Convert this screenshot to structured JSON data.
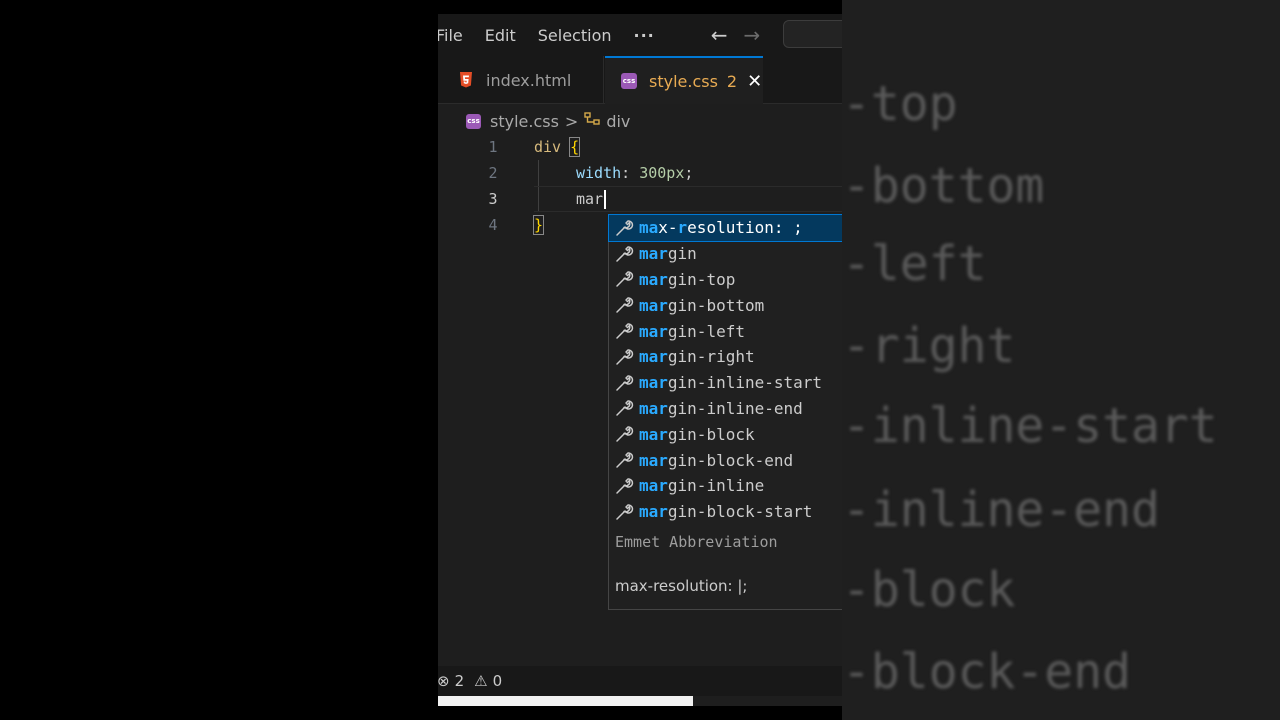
{
  "menubar": {
    "items": [
      "File",
      "Edit",
      "Selection",
      "···"
    ],
    "back_arrow": "←",
    "forward_arrow": "→"
  },
  "tabs": [
    {
      "label": "index.html",
      "icon": "html5-icon"
    },
    {
      "label": "style.css",
      "icon": "css-file-icon",
      "badge": "2",
      "close": "✕"
    }
  ],
  "breadcrumb": {
    "file": "style.css",
    "separator": ">",
    "symbol": "div"
  },
  "editor": {
    "line_numbers": [
      "1",
      "2",
      "3",
      "4"
    ],
    "line1": {
      "selector": "div",
      "brace": "{"
    },
    "line2": {
      "property": "width",
      "colon": ":",
      "value": "300px",
      "semi": ";"
    },
    "line3": {
      "typed": "mar"
    },
    "line4": {
      "brace": "}"
    }
  },
  "suggestions": {
    "query": "mar",
    "items": [
      {
        "prefix": "ma",
        "mid": "x-",
        "hl2": "r",
        "rest": "esolution: ;"
      },
      {
        "prefix": "mar",
        "rest": "gin"
      },
      {
        "prefix": "mar",
        "rest": "gin-top"
      },
      {
        "prefix": "mar",
        "rest": "gin-bottom"
      },
      {
        "prefix": "mar",
        "rest": "gin-left"
      },
      {
        "prefix": "mar",
        "rest": "gin-right"
      },
      {
        "prefix": "mar",
        "rest": "gin-inline-start"
      },
      {
        "prefix": "mar",
        "rest": "gin-inline-end"
      },
      {
        "prefix": "mar",
        "rest": "gin-block"
      },
      {
        "prefix": "mar",
        "rest": "gin-block-end"
      },
      {
        "prefix": "mar",
        "rest": "gin-inline"
      },
      {
        "prefix": "mar",
        "rest": "gin-block-start"
      }
    ],
    "details_title": "Emmet Abbreviation",
    "details_body": "max-resolution: |;"
  },
  "statusbar": {
    "errors": "2",
    "warnings": "0"
  },
  "background_words": [
    "-top",
    "-bottom",
    "-left",
    "-right",
    "-inline-start",
    "-inline-end",
    "-block",
    "-block-end"
  ],
  "colors": {
    "accent": "#0078d4",
    "match": "#2aaaff",
    "tab_modified": "#e8ab53"
  }
}
